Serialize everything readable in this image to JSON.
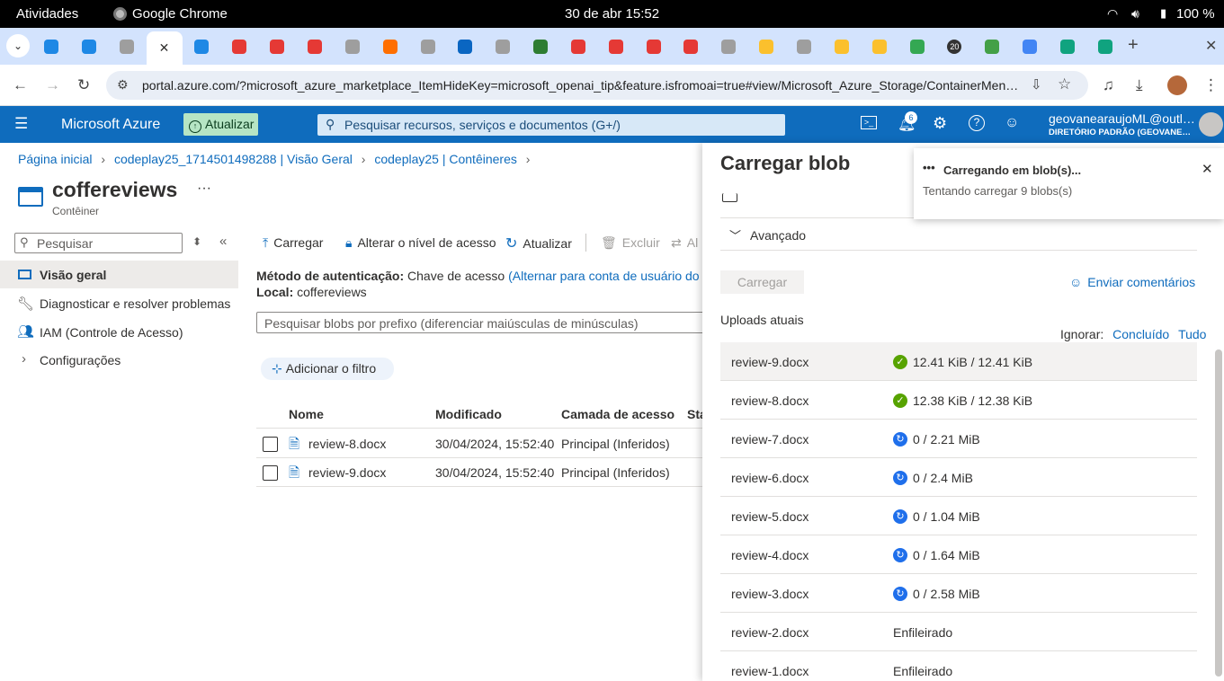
{
  "system_bar": {
    "activities": "Atividades",
    "app": "Google Chrome",
    "datetime": "30 de abr  15:52",
    "battery": "100 %"
  },
  "browser": {
    "url": "portal.azure.com/?microsoft_azure_marketplace_ItemHideKey=microsoft_openai_tip&feature.isfromoai=true#view/Microsoft_Azure_Storage/ContainerMenu…",
    "tab_colors": [
      "#1e88e5",
      "#1e88e5",
      "#9e9e9e",
      "#ffffff",
      "#1e88e5",
      "#e53935",
      "#e53935",
      "#e53935",
      "#9e9e9e",
      "#ff6f00",
      "#9e9e9e",
      "#0a66c2",
      "#9e9e9e",
      "#2e7d32",
      "#e53935",
      "#e53935",
      "#e53935",
      "#e53935",
      "#9e9e9e",
      "#fbc02d",
      "#9e9e9e",
      "#fbc02d",
      "#fbc02d",
      "#34a853",
      "#333333",
      "#43a047",
      "#4285f4",
      "#10a37f",
      "#10a37f"
    ],
    "notification_count": "20"
  },
  "azure": {
    "brand": "Microsoft Azure",
    "update_button": "Atualizar",
    "search_placeholder": "Pesquisar recursos, serviços e documentos (G+/)",
    "bell_count": "6",
    "user_email": "geovanearaujoML@outl…",
    "user_dir": "DIRETÓRIO PADRÃO (GEOVANE…"
  },
  "breadcrumb": [
    "Página inicial",
    "codeplay25_1714501498288 | Visão Geral",
    "codeplay25 | Contêineres"
  ],
  "page": {
    "title": "coffereviews",
    "subtitle": "Contêiner",
    "more": "···"
  },
  "leftnav": {
    "search_placeholder": "Pesquisar",
    "items": [
      "Visão geral",
      "Diagnosticar e resolver problemas",
      "IAM (Controle de Acesso)",
      "Configurações"
    ]
  },
  "toolbar": {
    "upload": "Carregar",
    "change_access": "Alterar o nível de acesso",
    "refresh": "Atualizar",
    "delete": "Excluir",
    "change_tier": "Al"
  },
  "auth": {
    "label": "Método de autenticação:",
    "value": "Chave de acesso",
    "switch_link": "(Alternar para conta de usuário do Microso",
    "location_label": "Local:",
    "location_value": "coffereviews"
  },
  "blob_search_placeholder": "Pesquisar blobs por prefixo (diferenciar maiúsculas de minúsculas)",
  "add_filter": "Adicionar o filtro",
  "table": {
    "headers": [
      "Nome",
      "Modificado",
      "Camada de acesso",
      "Sta"
    ],
    "rows": [
      {
        "name": "review-8.docx",
        "modified": "30/04/2024, 15:52:40",
        "tier": "Principal (Inferidos)"
      },
      {
        "name": "review-9.docx",
        "modified": "30/04/2024, 15:52:40",
        "tier": "Principal (Inferidos)"
      }
    ]
  },
  "blade": {
    "title": "Carregar blob",
    "advanced": "Avançado",
    "upload_button": "Carregar",
    "feedback": "Enviar comentários",
    "current_uploads": "Uploads atuais",
    "ignore_label": "Ignorar:",
    "ignore_done": "Concluído",
    "ignore_all": "Tudo",
    "uploads": [
      {
        "name": "review-9.docx",
        "status": "12.41 KiB / 12.41 KiB",
        "state": "done"
      },
      {
        "name": "review-8.docx",
        "status": "12.38 KiB / 12.38 KiB",
        "state": "done"
      },
      {
        "name": "review-7.docx",
        "status": "0 / 2.21 MiB",
        "state": "progress"
      },
      {
        "name": "review-6.docx",
        "status": "0 / 2.4 MiB",
        "state": "progress"
      },
      {
        "name": "review-5.docx",
        "status": "0 / 1.04 MiB",
        "state": "progress"
      },
      {
        "name": "review-4.docx",
        "status": "0 / 1.64 MiB",
        "state": "progress"
      },
      {
        "name": "review-3.docx",
        "status": "0 / 2.58 MiB",
        "state": "progress"
      },
      {
        "name": "review-2.docx",
        "status": "Enfileirado",
        "state": "queued"
      },
      {
        "name": "review-1.docx",
        "status": "Enfileirado",
        "state": "queued"
      }
    ]
  },
  "toast": {
    "title": "Carregando em blob(s)...",
    "body": "Tentando carregar 9 blobs(s)"
  }
}
